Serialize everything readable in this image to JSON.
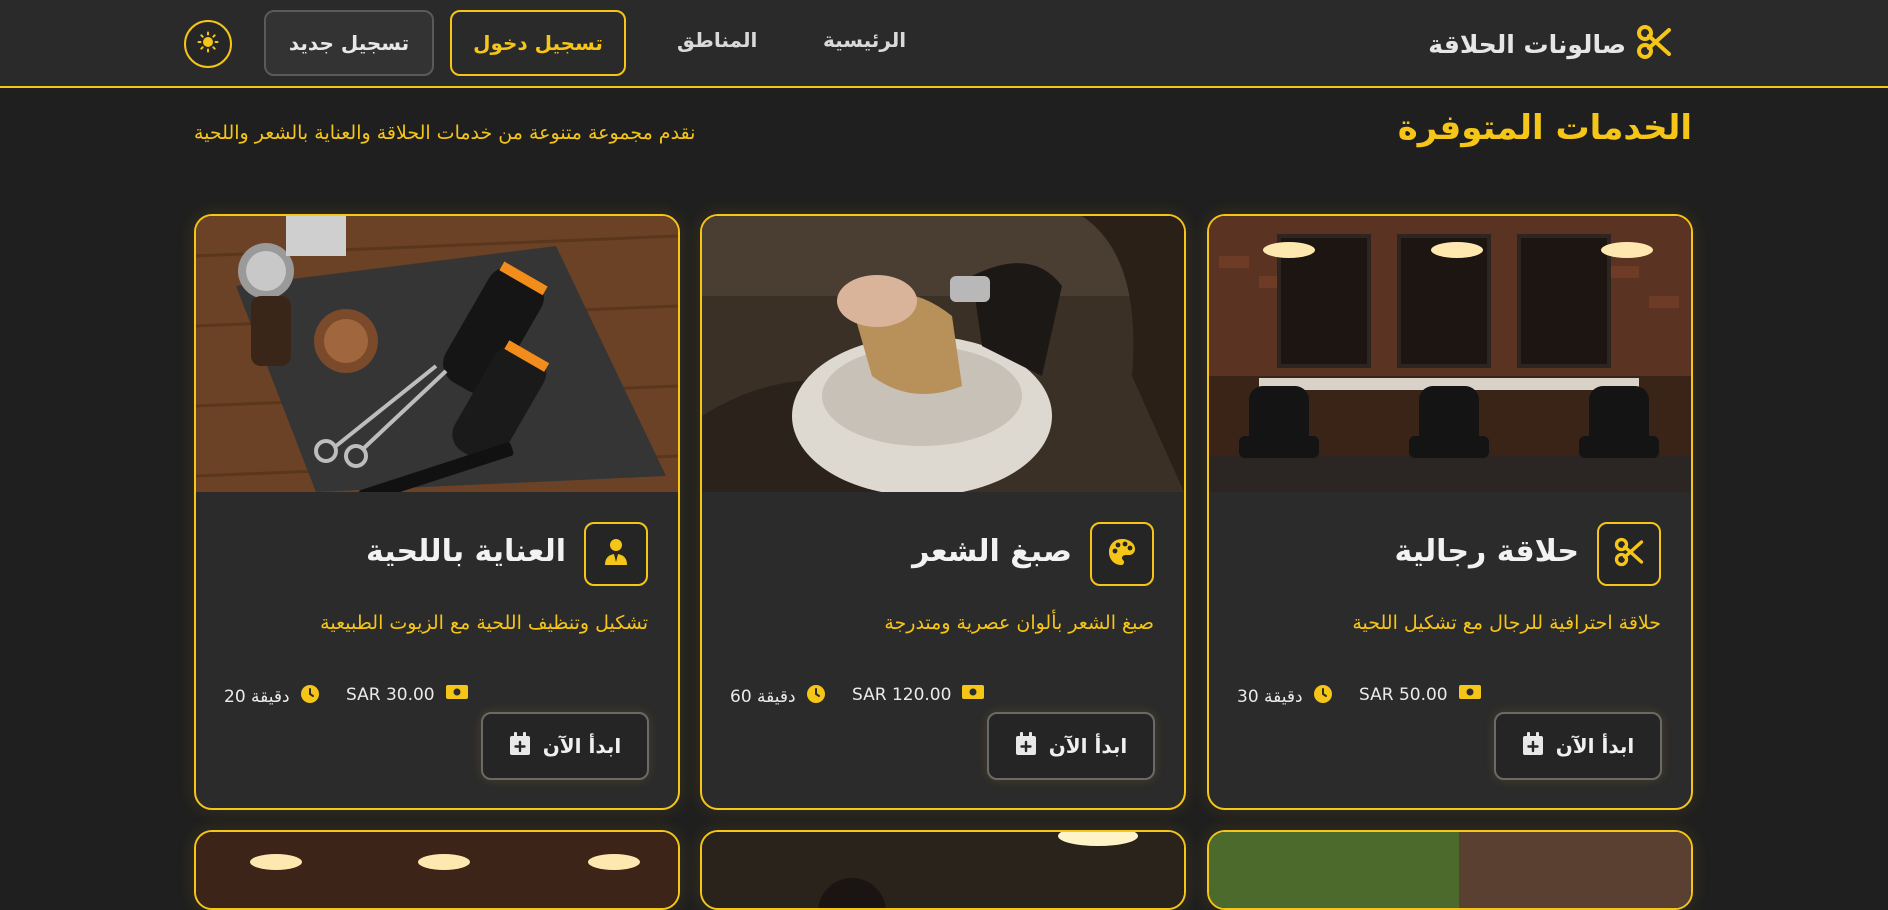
{
  "header": {
    "brand": "صالونات الحلاقة",
    "nav": [
      {
        "label": "الرئيسية"
      },
      {
        "label": "المناطق"
      }
    ],
    "login_label": "تسجيل دخول",
    "register_label": "تسجيل جديد"
  },
  "section": {
    "title": "الخدمات المتوفرة",
    "subtitle": "نقدم مجموعة متنوعة من خدمات الحلاقة والعناية بالشعر واللحية"
  },
  "services": [
    {
      "title": "حلاقة رجالية",
      "description": "حلاقة احترافية للرجال مع تشكيل اللحية",
      "price": "SAR 50.00",
      "duration": "30 دقيقة",
      "cta": "ابدأ الآن",
      "icon": "scissors-icon"
    },
    {
      "title": "صبغ الشعر",
      "description": "صبغ الشعر بألوان عصرية ومتدرجة",
      "price": "SAR 120.00",
      "duration": "60 دقيقة",
      "cta": "ابدأ الآن",
      "icon": "palette-icon"
    },
    {
      "title": "العناية باللحية",
      "description": "تشكيل وتنظيف اللحية مع الزيوت الطبيعية",
      "price": "SAR 30.00",
      "duration": "20 دقيقة",
      "cta": "ابدأ الآن",
      "icon": "user-tie-icon"
    }
  ],
  "colors": {
    "accent": "#f5c518",
    "background": "#1f1f1f",
    "card": "#2b2b2b"
  }
}
